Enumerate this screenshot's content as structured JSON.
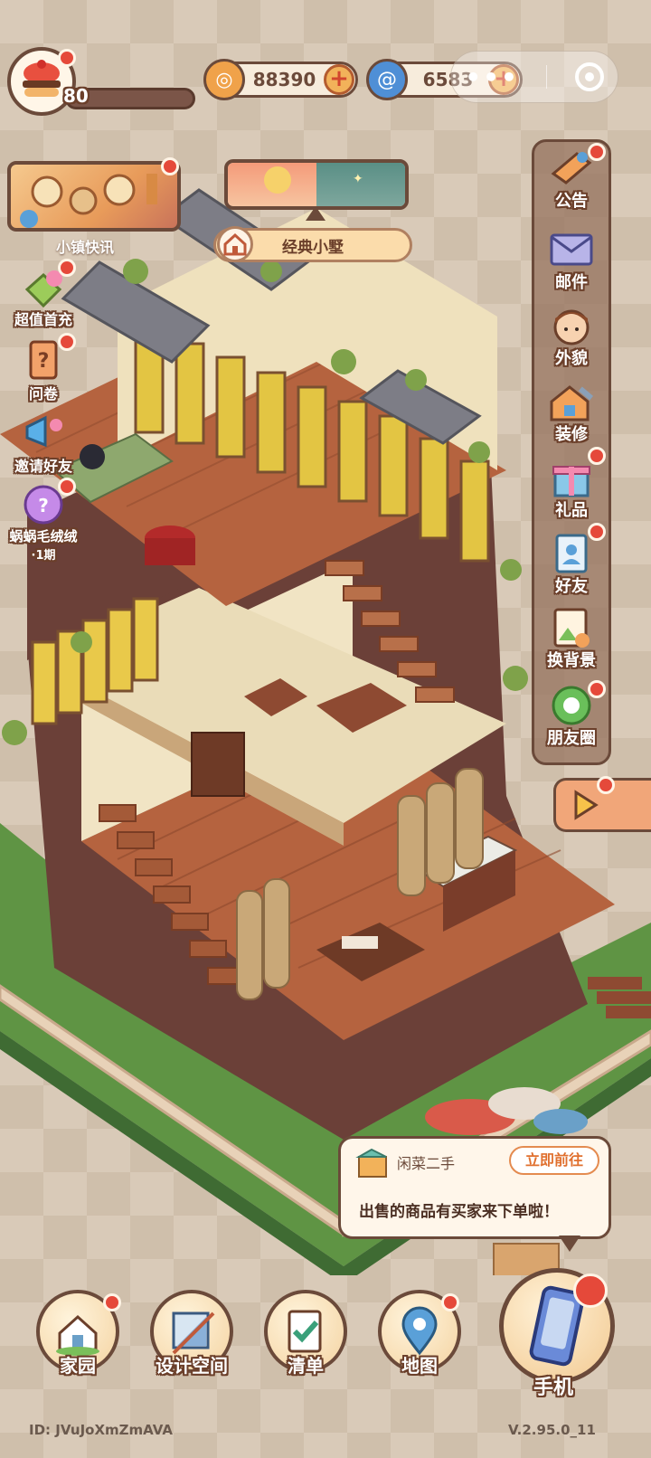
{
  "player": {
    "level": "80",
    "avatar_icon": "burger-cake-icon"
  },
  "currencies": [
    {
      "name": "coins",
      "value": "88390",
      "icon": "coin-icon",
      "color": "#f0a24a"
    },
    {
      "name": "gems",
      "value": "6583",
      "icon": "swirl-gem-icon",
      "color": "#4f8fd6"
    }
  ],
  "header": {
    "more_icon": "more-dots-icon",
    "close_icon": "target-circle-icon"
  },
  "news": {
    "label": "小镇快讯"
  },
  "house_style": {
    "label": "经典小墅"
  },
  "left_menu": [
    {
      "id": "recharge",
      "label": "超值首充",
      "icon": "gift-leaf-icon"
    },
    {
      "id": "survey",
      "label": "问卷",
      "icon": "question-tag-icon"
    },
    {
      "id": "invite",
      "label": "邀请好友",
      "icon": "megaphone-icon"
    },
    {
      "id": "wool",
      "label": "蜗蜗毛绒绒",
      "sublabel": "·1期",
      "icon": "snail-plush-icon"
    }
  ],
  "right_menu": [
    {
      "id": "notice",
      "label": "公告",
      "icon": "announcement-bird-icon"
    },
    {
      "id": "mail",
      "label": "邮件",
      "icon": "envelope-icon"
    },
    {
      "id": "appearance",
      "label": "外貌",
      "icon": "face-icon"
    },
    {
      "id": "decorate",
      "label": "装修",
      "icon": "house-wrench-icon"
    },
    {
      "id": "gift",
      "label": "礼品",
      "icon": "gift-box-icon"
    },
    {
      "id": "friends",
      "label": "好友",
      "icon": "friends-book-icon"
    },
    {
      "id": "background",
      "label": "换背景",
      "icon": "background-image-icon"
    },
    {
      "id": "moments",
      "label": "朋友圈",
      "icon": "moments-icon"
    }
  ],
  "notification": {
    "app": "闲菜二手",
    "button": "立即前往",
    "message": "出售的商品有买家来下单啦！"
  },
  "bottom_nav": [
    {
      "id": "home",
      "label": "家园",
      "icon": "home-icon"
    },
    {
      "id": "design",
      "label": "设计空间",
      "icon": "design-ruler-icon"
    },
    {
      "id": "list",
      "label": "清单",
      "icon": "checklist-icon"
    },
    {
      "id": "map",
      "label": "地图",
      "icon": "map-pin-icon"
    },
    {
      "id": "phone",
      "label": "手机",
      "icon": "phone-icon"
    }
  ],
  "footer": {
    "player_id": "ID: JVuJoXmZmAVA",
    "version": "V.2.95.0_11"
  }
}
